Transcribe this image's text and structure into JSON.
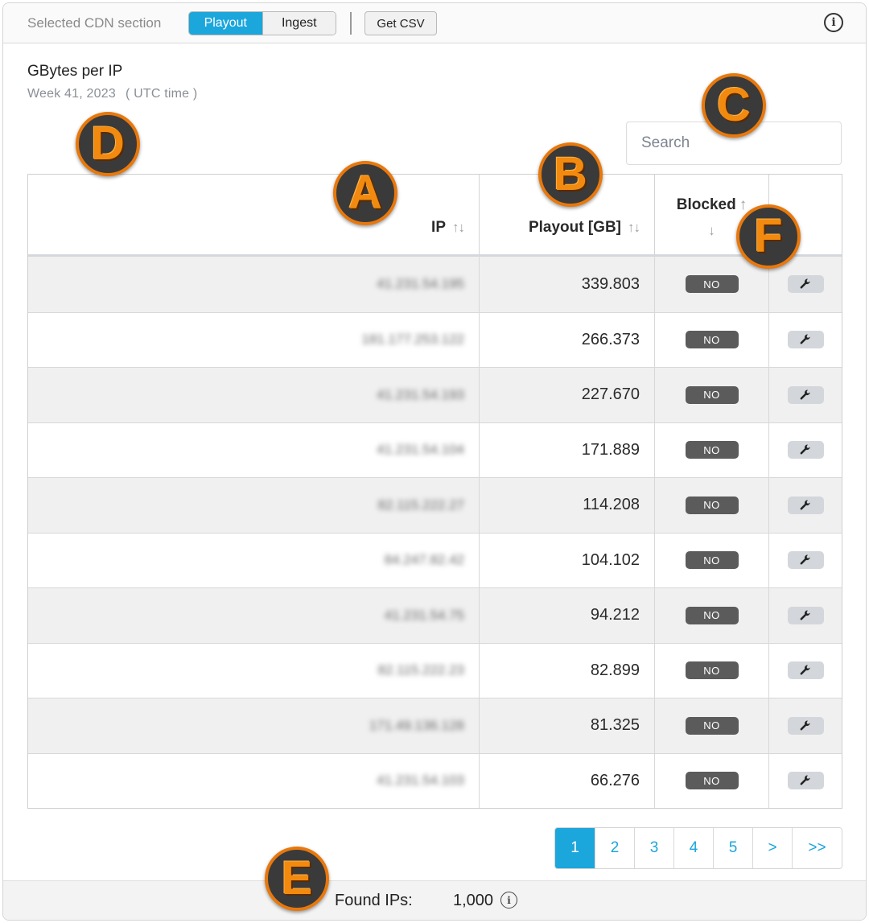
{
  "toolbar": {
    "section_label": "Selected CDN section",
    "segments": [
      "Playout",
      "Ingest"
    ],
    "active_segment": "Playout",
    "csv_button": "Get CSV",
    "info_glyph": "i"
  },
  "header": {
    "title": "GBytes per IP",
    "week": "Week 41, 2023",
    "timezone": "( UTC time )"
  },
  "search": {
    "placeholder": "Search"
  },
  "table": {
    "columns": {
      "ip": "IP",
      "playout": "Playout [GB]",
      "blocked": "Blocked",
      "sort_arrows": "↑↓",
      "sort_up": "↑",
      "sort_down": "↓"
    },
    "rows": [
      {
        "ip": "41.231.54.195",
        "playout": "339.803",
        "blocked": "NO"
      },
      {
        "ip": "181.177.253.122",
        "playout": "266.373",
        "blocked": "NO"
      },
      {
        "ip": "41.231.54.193",
        "playout": "227.670",
        "blocked": "NO"
      },
      {
        "ip": "41.231.54.104",
        "playout": "171.889",
        "blocked": "NO"
      },
      {
        "ip": "82.115.222.27",
        "playout": "114.208",
        "blocked": "NO"
      },
      {
        "ip": "84.247.82.42",
        "playout": "104.102",
        "blocked": "NO"
      },
      {
        "ip": "41.231.54.75",
        "playout": "94.212",
        "blocked": "NO"
      },
      {
        "ip": "82.115.222.23",
        "playout": "82.899",
        "blocked": "NO"
      },
      {
        "ip": "171.49.136.128",
        "playout": "81.325",
        "blocked": "NO"
      },
      {
        "ip": "41.231.54.103",
        "playout": "66.276",
        "blocked": "NO"
      }
    ]
  },
  "pagination": {
    "pages": [
      "1",
      "2",
      "3",
      "4",
      "5",
      ">",
      ">>"
    ],
    "active": "1"
  },
  "footer": {
    "found_label": "Found IPs:",
    "found_value": "1,000",
    "info_glyph": "i"
  },
  "callouts": [
    "A",
    "B",
    "C",
    "D",
    "E",
    "F"
  ],
  "colors": {
    "accent": "#1ba6dc",
    "badge": "#5b5b5b",
    "callout_orange": "#f28a0f"
  }
}
